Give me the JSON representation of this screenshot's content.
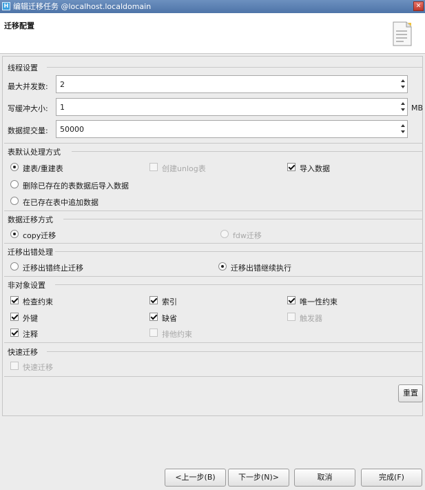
{
  "window": {
    "title": "编辑迁移任务 @localhost.localdomain",
    "app_icon": "H",
    "close": "✕"
  },
  "header": {
    "title": "迁移配置"
  },
  "thread": {
    "label": "线程设置",
    "max_concurrency_label": "最大并发数:",
    "max_concurrency": "2",
    "write_buffer_label": "写缓冲大小:",
    "write_buffer": "1",
    "write_buffer_unit": "MB",
    "batch_label": "数据提交量:",
    "batch": "50000"
  },
  "table_handling": {
    "label": "表默认处理方式",
    "create": "建表/重建表",
    "create_unlog": "创建unlog表",
    "import_data": "导入数据",
    "delete_import": "删除已存在的表数据后导入数据",
    "append": "在已存在表中追加数据"
  },
  "migration_mode": {
    "label": "数据迁移方式",
    "copy": "copy迁移",
    "fdw": "fdw迁移"
  },
  "error_handling": {
    "label": "迁移出错处理",
    "stop": "迁移出错终止迁移",
    "continue": "迁移出错继续执行"
  },
  "non_object": {
    "label": "非对象设置",
    "check_constraint": "检查约束",
    "index": "索引",
    "unique": "唯一性约束",
    "foreign_key": "外键",
    "default": "缺省",
    "trigger": "触发器",
    "comment": "注释",
    "exclude": "排他约束"
  },
  "fast": {
    "label": "快速迁移",
    "fast_migration": "快速迁移"
  },
  "reset": "重置",
  "footer": {
    "prev": "<上一步(B)",
    "next": "下一步(N)>",
    "cancel": "取消",
    "finish": "完成(F)"
  }
}
